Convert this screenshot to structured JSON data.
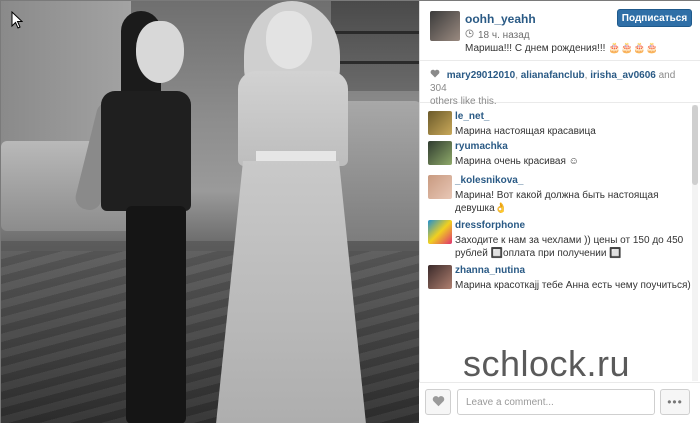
{
  "post": {
    "username": "oohh_yeahh",
    "time": "18 ч. назад",
    "caption": "Мариша!!! С днем рождения!!! 🎂🎂🎂🎂",
    "follow_label": "Подписаться"
  },
  "likes": {
    "likers": [
      "mary29012010",
      "alianafanclub",
      "irisha_av0606"
    ],
    "separator": ", ",
    "suffix_and": " and 304",
    "suffix_rest": "others like this."
  },
  "comments": [
    {
      "user": "le_net_",
      "text": "Марина настоящая красавица"
    },
    {
      "user": "ryumachka",
      "text": "Марина очень красивая ☺"
    },
    {
      "user": "_kolesnikova_",
      "text": "Марина! Вот какой должна быть настоящая девушка👌"
    },
    {
      "user": "dressforphone",
      "text": "Заходите к нам за чехлами )) цены от 150 до 450 рублей 🔲оплата при получении 🔲"
    },
    {
      "user": "zhanna_nutina",
      "text": "Марина красоткаjj тебе Анна есть чему поучиться)"
    }
  ],
  "composer": {
    "placeholder": "Leave a comment...",
    "more_label": "•••"
  },
  "watermark": "schlock.ru",
  "icons": {
    "heart": "heart-icon",
    "clock": "clock-icon",
    "more": "more-dots-icon",
    "cursor": "pointer-cursor-icon"
  },
  "colors": {
    "link": "#2a5a85",
    "follow_button": "#2f6fa7",
    "muted": "#8a8a8a"
  }
}
